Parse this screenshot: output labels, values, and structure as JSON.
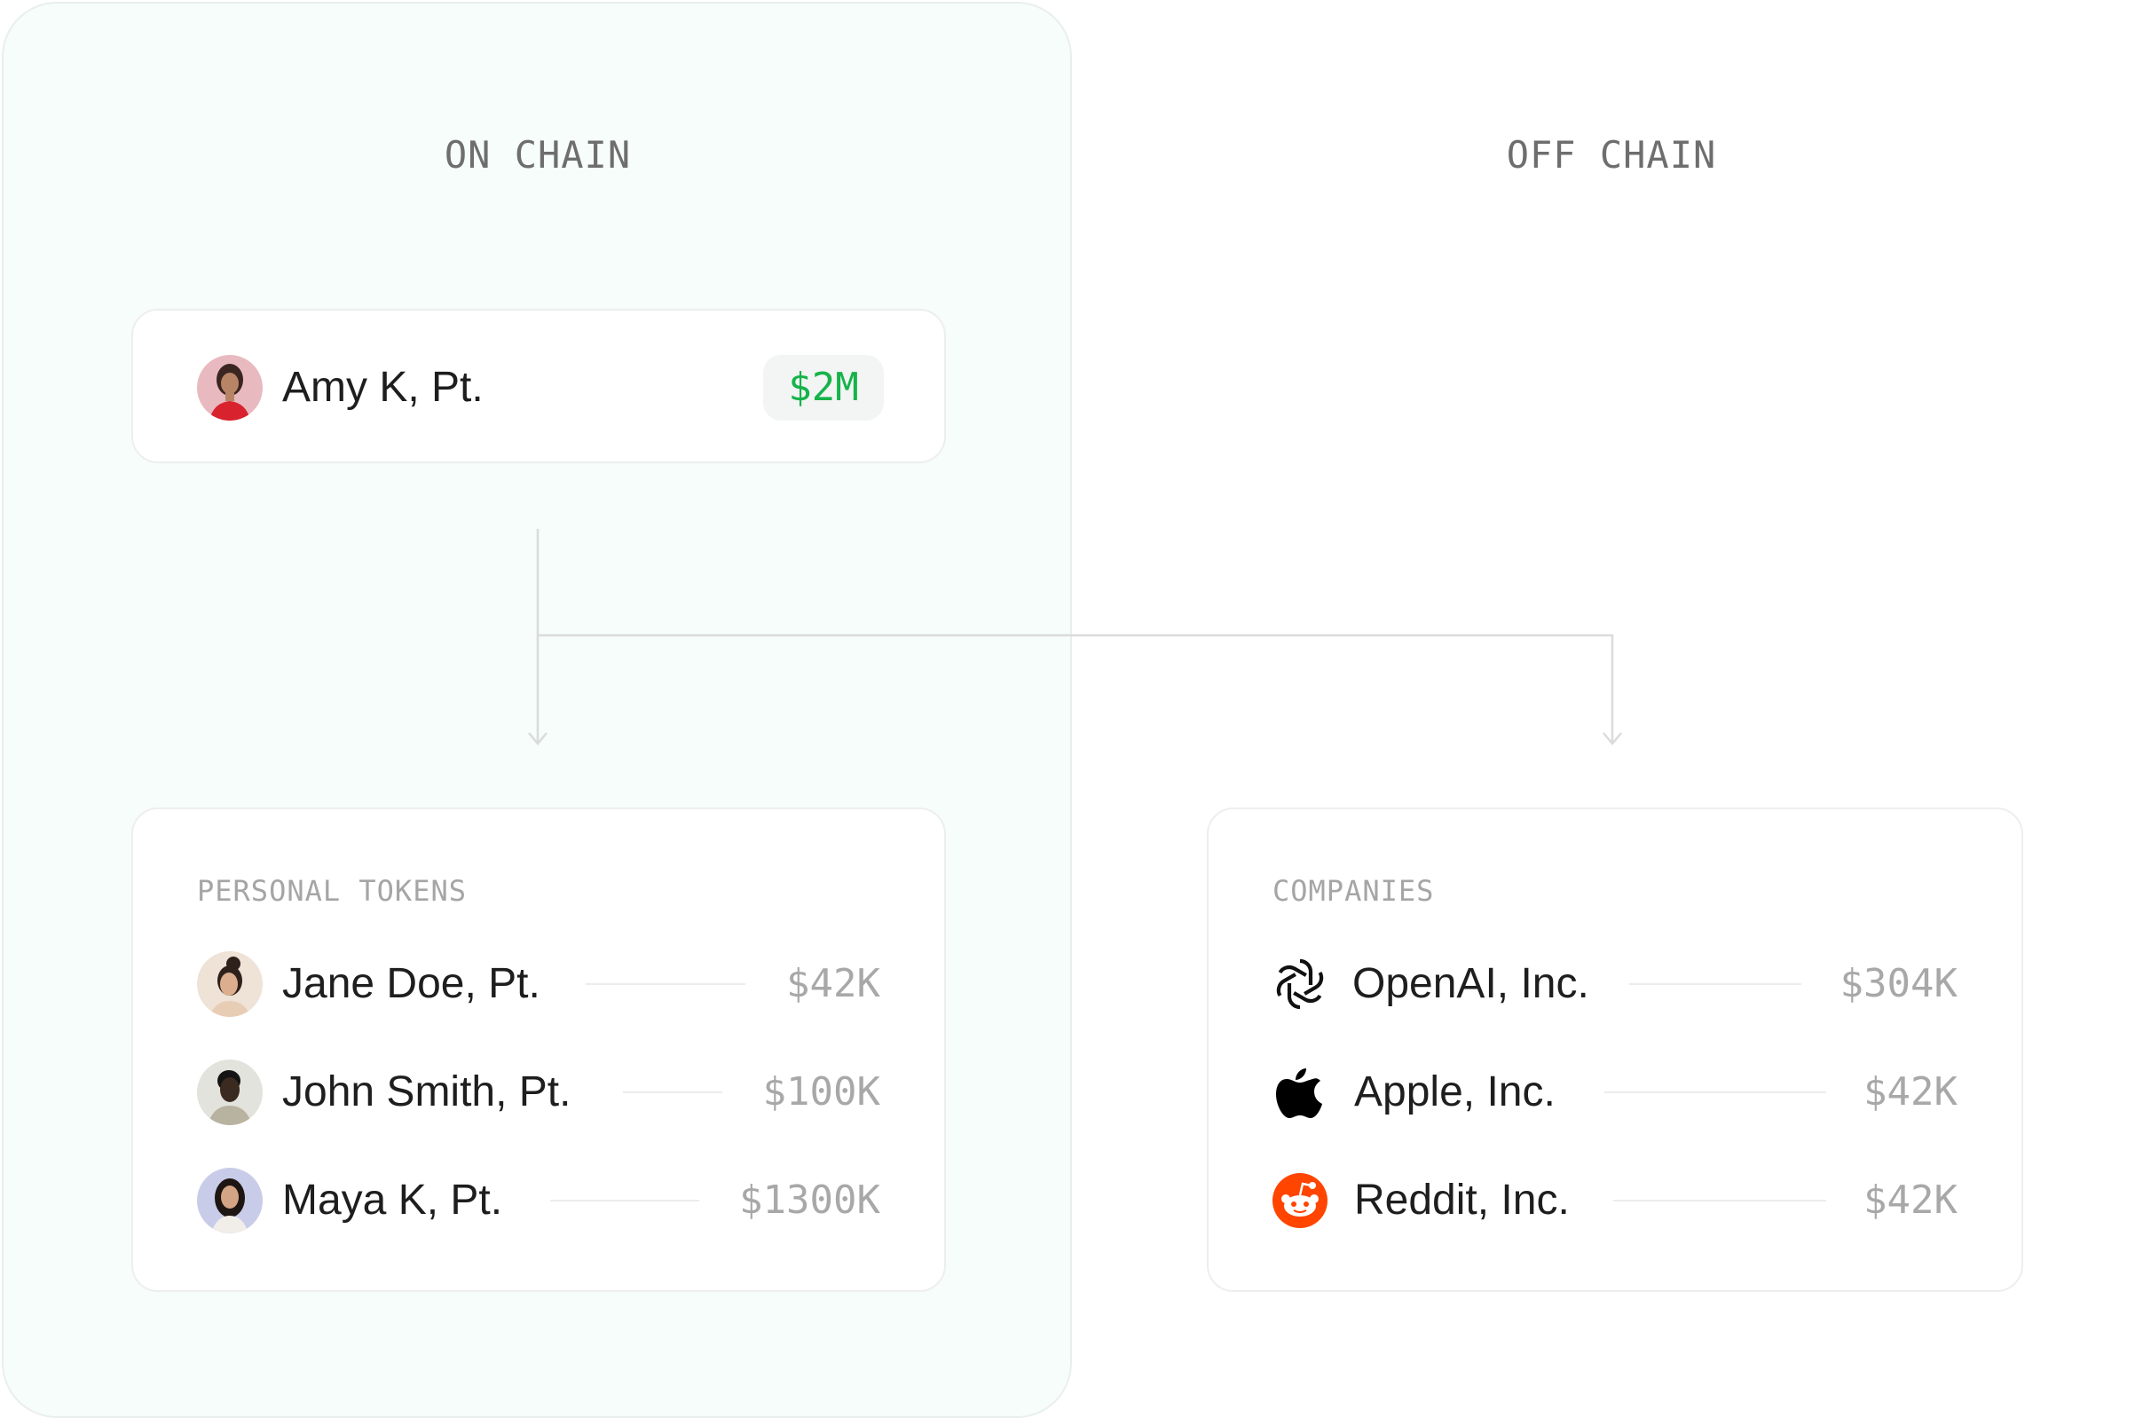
{
  "sections": {
    "on_chain": "ON CHAIN",
    "off_chain": "OFF CHAIN"
  },
  "featured": {
    "name": "Amy K, Pt.",
    "value": "$2M",
    "accent_color": "#16b34a"
  },
  "personal_tokens": {
    "label": "PERSONAL TOKENS",
    "items": [
      {
        "name": "Jane Doe, Pt.",
        "value": "$42K"
      },
      {
        "name": "John Smith, Pt.",
        "value": "$100K"
      },
      {
        "name": "Maya K, Pt.",
        "value": "$1300K"
      }
    ]
  },
  "companies": {
    "label": "COMPANIES",
    "items": [
      {
        "name": "OpenAI, Inc.",
        "value": "$304K",
        "icon": "openai-logo-icon"
      },
      {
        "name": "Apple, Inc.",
        "value": "$42K",
        "icon": "apple-logo-icon"
      },
      {
        "name": "Reddit, Inc.",
        "value": "$42K",
        "icon": "reddit-logo-icon"
      }
    ]
  },
  "colors": {
    "on_chain_panel": "#f6fdfa",
    "reddit": "#ff4500"
  }
}
